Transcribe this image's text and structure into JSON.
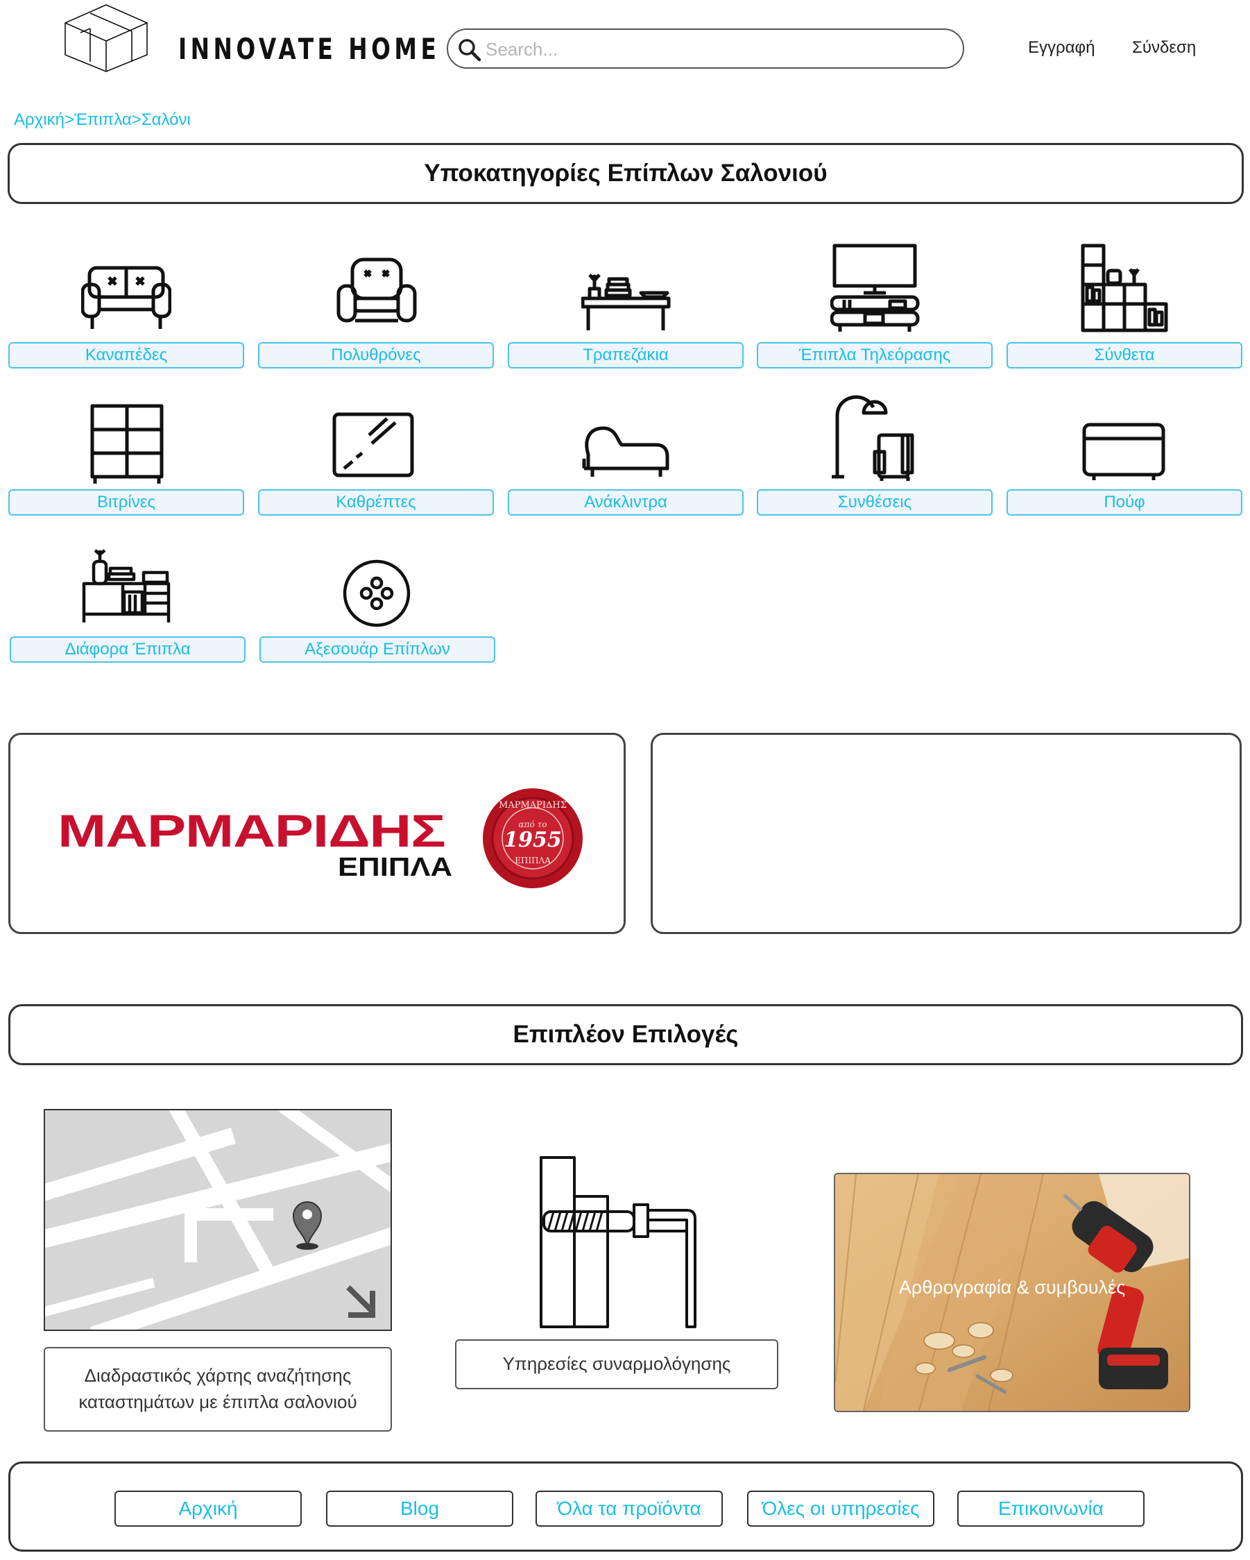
{
  "header": {
    "brand": "INNOVATE HOME",
    "search_placeholder": "Search...",
    "nav": {
      "register": "Εγγραφή",
      "login": "Σύνδεση"
    }
  },
  "breadcrumb": "Αρχική>Έπιπλα>Σαλόνι",
  "categories": {
    "title": "Υποκατηγορίες Επίπλων Σαλονιού",
    "items": [
      {
        "label": "Καναπέδες",
        "icon": "sofa-icon"
      },
      {
        "label": "Πολυθρόνες",
        "icon": "armchair-icon"
      },
      {
        "label": "Τραπεζάκια",
        "icon": "coffee-table-icon"
      },
      {
        "label": "Έπιπλα Τηλεόρασης",
        "icon": "tv-unit-icon"
      },
      {
        "label": "Σύνθετα",
        "icon": "wall-unit-icon"
      },
      {
        "label": "Βιτρίνες",
        "icon": "display-cabinet-icon"
      },
      {
        "label": "Καθρέπτες",
        "icon": "mirror-icon"
      },
      {
        "label": "Ανάκλιντρα",
        "icon": "chaise-longue-icon"
      },
      {
        "label": "Συνθέσεις",
        "icon": "floor-lamp-armchair-icon"
      },
      {
        "label": "Πούφ",
        "icon": "pouf-icon"
      },
      {
        "label": "Διάφορα Έπιπλα",
        "icon": "misc-furniture-icon"
      },
      {
        "label": "Αξεσουάρ Επίπλων",
        "icon": "button-accessory-icon"
      }
    ]
  },
  "ads": {
    "left": {
      "logo_text": "ΜΑΡΜΑΡΙΔΗΣ",
      "logo_sub": "ΕΠΙΠΛΑ",
      "seal_year": "1955",
      "seal_from": "από το",
      "seal_ring": "ΜΑΡΜΑΡΙΔΗΣ",
      "seal_bottom": "ΕΠΙΠΛΑ",
      "brand_color": "#c8102e"
    }
  },
  "extras": {
    "title": "Επιπλέον Επιλογές",
    "map_label_line1": "Διαδραστικός χάρτης αναζήτησης",
    "map_label_line2": "καταστημάτων με έπιπλα σαλονιού",
    "assembly_label": "Υπηρεσίες συναρμολόγησης",
    "articles_label": "Αρθρογραφία & συμβουλές"
  },
  "footer": {
    "links": [
      "Αρχική",
      "Blog",
      "Όλα τα προϊόντα",
      "Όλες οι υπηρεσίες",
      "Επικοινωνία"
    ]
  },
  "colors": {
    "accent": "#19bde6",
    "label_bg": "#eef5fc"
  }
}
